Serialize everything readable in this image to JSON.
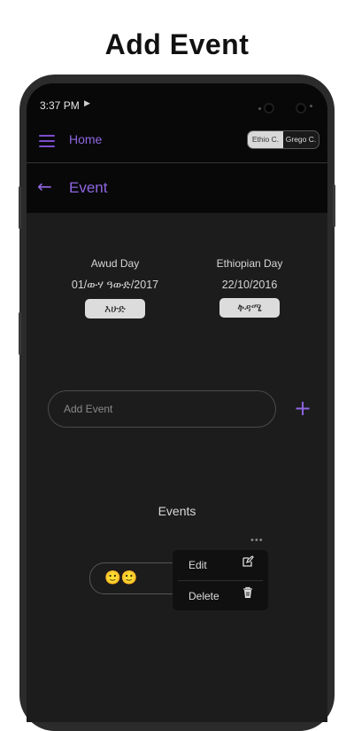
{
  "promo": {
    "headline": "Add Event"
  },
  "status_bar": {
    "time": "3:37 PM",
    "media_icon": "play-icon"
  },
  "app_bar": {
    "title": "Home",
    "calendar_toggle": {
      "options": [
        "Ethio C.",
        "Grego C."
      ],
      "selected": "Ethio C."
    }
  },
  "page_header": {
    "title": "Event",
    "back_icon": "arrow-left-icon"
  },
  "dates": {
    "awud": {
      "label": "Awud Day",
      "value": "01/ውሃ ዓውድ/2017",
      "day_button": "እሁድ"
    },
    "ethiopian": {
      "label": "Ethiopian Day",
      "value": "22/10/2016",
      "day_button": "ቅዳሜ"
    }
  },
  "add_event": {
    "placeholder": "Add Event",
    "value": "",
    "add_icon": "plus-icon"
  },
  "events_section": {
    "heading": "Events",
    "items": [
      {
        "label": "🙂🙂"
      }
    ]
  },
  "context_menu": {
    "items": [
      {
        "label": "Edit",
        "icon": "edit-icon"
      },
      {
        "label": "Delete",
        "icon": "trash-icon"
      }
    ]
  },
  "colors": {
    "accent": "#8e66e0",
    "background": "#1c1c1c",
    "bar_background": "#080808"
  }
}
